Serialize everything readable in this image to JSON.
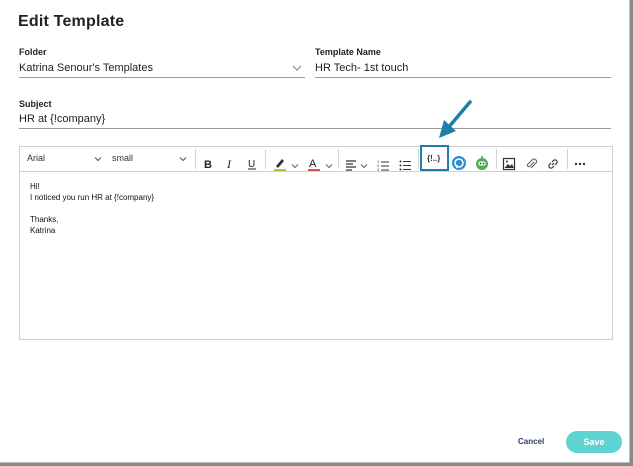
{
  "dialog": {
    "title": "Edit Template",
    "folder_label": "Folder",
    "folder_value": "Katrina Senour's Templates",
    "template_name_label": "Template Name",
    "template_name_value": "HR Tech- 1st touch",
    "subject_label": "Subject",
    "subject_value": "HR at {!company}"
  },
  "toolbar": {
    "font_family": "Arial",
    "font_size": "small",
    "merge_field_label": "{!..}"
  },
  "editor_body": {
    "line1": "Hi!",
    "line2": "I noticed you run HR at {!company}",
    "line3": "Thanks,",
    "line4": "Katrina"
  },
  "footer": {
    "cancel_label": "Cancel",
    "save_label": "Save"
  },
  "colors": {
    "save_button": "#5ed3cf",
    "annotation_arrow": "#1e7fa8",
    "cancel_text": "#2a3f5f"
  }
}
